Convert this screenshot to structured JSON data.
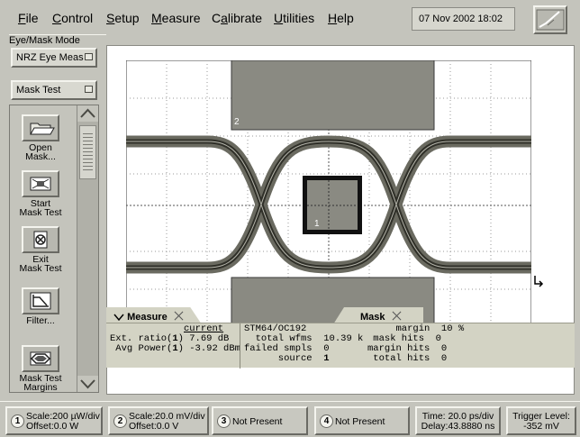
{
  "menu": {
    "items": [
      {
        "label": "File",
        "u": "F",
        "rest": "ile"
      },
      {
        "label": "Control",
        "u": "C",
        "rest": "ontrol"
      },
      {
        "label": "Setup",
        "u": "S",
        "rest": "etup"
      },
      {
        "label": "Measure",
        "u": "M",
        "rest": "easure"
      },
      {
        "label": "Calibrate",
        "u": "a",
        "pre": "C",
        "rest": "librate"
      },
      {
        "label": "Utilities",
        "u": "U",
        "rest": "tilities"
      },
      {
        "label": "Help",
        "u": "H",
        "rest": "elp"
      }
    ],
    "datetime": "07 Nov 2002   18:02"
  },
  "left_panel": {
    "mode_label": "Eye/Mask Mode",
    "mode_select": "NRZ Eye Meas",
    "test_select": "Mask Test",
    "buttons": [
      {
        "label": "Open\nMask...",
        "icon": "open-folder-icon"
      },
      {
        "label": "Start\nMask Test",
        "icon": "start-mask-icon"
      },
      {
        "label": "Exit\nMask Test",
        "icon": "exit-mask-icon"
      },
      {
        "label": "Filter...",
        "icon": "filter-icon"
      },
      {
        "label": "Mask Test\nMargins",
        "icon": "margins-icon"
      }
    ]
  },
  "display": {
    "mask_labels": [
      "2",
      "1"
    ]
  },
  "measure_panel": {
    "tab_measure": "Measure",
    "tab_mask": "Mask",
    "col_header": "current",
    "rows": [
      {
        "name": "Ext. ratio(",
        "ch": "1",
        "end": ")",
        "value": "7.69 dB"
      },
      {
        "name": " Avg Power(",
        "ch": "1",
        "end": ")",
        "value": "-3.92 dBm"
      }
    ],
    "mask_name": "STM64/OC192",
    "stats_left": [
      {
        "label": "  total wfms",
        "value": "10.39 k"
      },
      {
        "label": "failed smpls",
        "value": "0"
      },
      {
        "label": "      source",
        "value": "1"
      }
    ],
    "stats_right": [
      {
        "label": "     margin",
        "value": "10 %"
      },
      {
        "label": " mask hits",
        "value": "0"
      },
      {
        "label": "margin hits",
        "value": "0"
      },
      {
        "label": " total hits",
        "value": "0"
      }
    ]
  },
  "bottom_bar": {
    "channels": [
      {
        "num": "1",
        "line1": "Scale:200 µW/div",
        "line2": "Offset:0.0 W"
      },
      {
        "num": "2",
        "line1": "Scale:20.0 mV/div",
        "line2": "Offset:0.0 V"
      },
      {
        "num": "3",
        "line1": "Not Present",
        "line2": ""
      },
      {
        "num": "4",
        "line1": "Not Present",
        "line2": ""
      }
    ],
    "time": {
      "line1": "Time: 20.0 ps/div",
      "line2": "Delay:43.8880 ns"
    },
    "trigger": {
      "line1": "Trigger Level:",
      "line2": "-352 mV"
    }
  }
}
